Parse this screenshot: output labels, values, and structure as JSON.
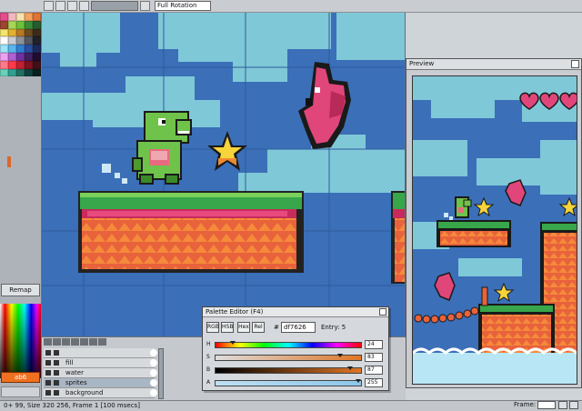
{
  "toolbar": {
    "view_mode": "Full Rotation"
  },
  "left_panel": {
    "palette": [
      "#e74c8c",
      "#f2b6c2",
      "#f7e3b0",
      "#f5a25d",
      "#e07434",
      "#9e4430",
      "#a7d656",
      "#6fbf3b",
      "#3a8c37",
      "#255c2e",
      "#f3e56b",
      "#e2b22f",
      "#b77a22",
      "#6d4b1f",
      "#3d2b1a",
      "#fdfdfd",
      "#c8cbd0",
      "#8d9299",
      "#525760",
      "#1f2228",
      "#9ee2f6",
      "#59b6ec",
      "#2f7fd1",
      "#2b4fa0",
      "#1b2a5c",
      "#f0a0f0",
      "#b060d0",
      "#7030a0",
      "#402060",
      "#200c30",
      "#ff7a8a",
      "#ff3a4a",
      "#c02030",
      "#801020",
      "#401018",
      "#6ad0b8",
      "#30a090",
      "#207060",
      "#104040",
      "#082020"
    ],
    "remap_label": "Remap",
    "hex_value": "ab6",
    "indicator_color": "#e0642c"
  },
  "layers": {
    "rows": [
      {
        "name": "",
        "selected": false
      },
      {
        "name": "fill",
        "selected": false
      },
      {
        "name": "water",
        "selected": false
      },
      {
        "name": "sprites",
        "selected": true
      },
      {
        "name": "background",
        "selected": false
      }
    ]
  },
  "preview": {
    "title": "Preview"
  },
  "palette_editor": {
    "title": "Palette Editor (F4)",
    "mode_buttons": [
      "RGB",
      "HSB",
      "Hex",
      "Rel"
    ],
    "hex_label": "#",
    "hex_value": "df7626",
    "entry": "Entry: 5",
    "sliders": [
      {
        "label": "H",
        "value": "24",
        "level": 0.1
      },
      {
        "label": "S",
        "value": "83",
        "level": 0.86
      },
      {
        "label": "B",
        "value": "87",
        "level": 0.93
      },
      {
        "label": "A",
        "value": "255",
        "level": 0.99
      }
    ]
  },
  "status": {
    "text": "0+ 99, Size 320 256, Frame 1 [100 msecs]",
    "frame_label": "Frame:"
  },
  "colors": {
    "sky": "#3b6fb8",
    "cloud": "#7fc8d8",
    "grass": "#38a64a",
    "ground": "#e8623c",
    "accent": "#f07020"
  }
}
